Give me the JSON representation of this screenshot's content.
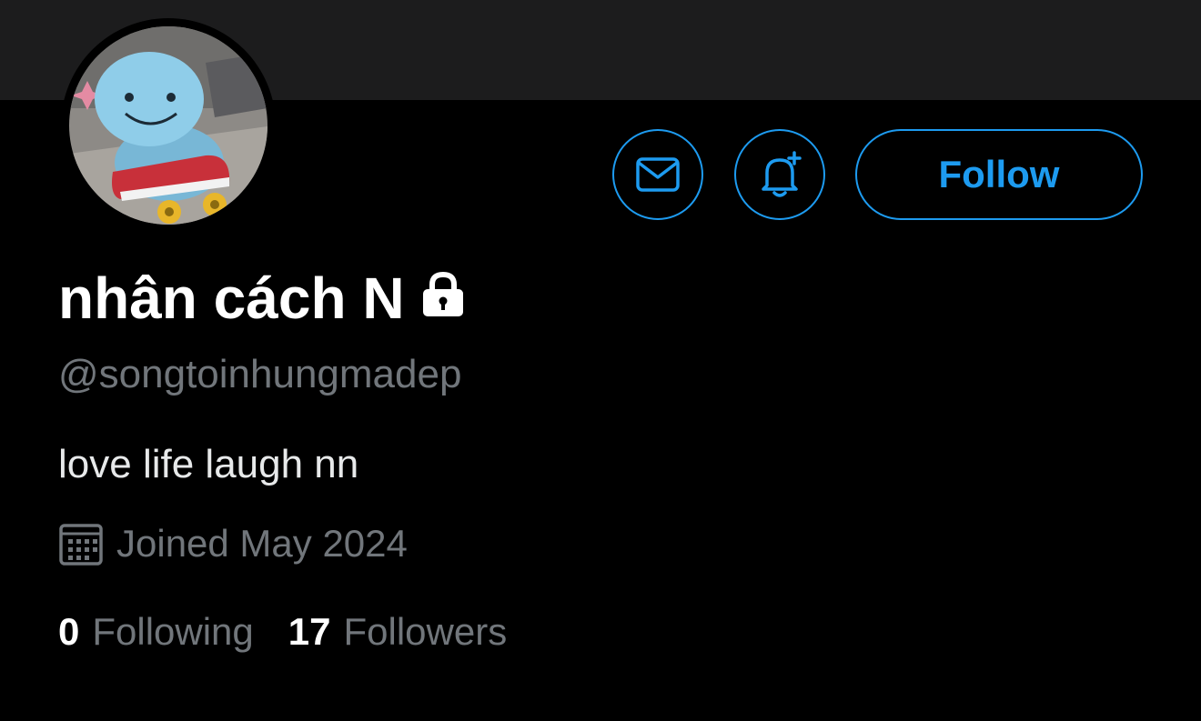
{
  "profile": {
    "display_name": "nhân cách N",
    "handle": "@songtoinhungmadep",
    "bio": "love life laugh nn",
    "joined": "Joined May 2024",
    "protected": true
  },
  "actions": {
    "follow_label": "Follow",
    "message_icon": "envelope-icon",
    "notify_icon": "bell-plus-icon"
  },
  "stats": {
    "following_count": "0",
    "following_label": "Following",
    "followers_count": "17",
    "followers_label": "Followers"
  },
  "colors": {
    "accent": "#1d9bf0",
    "background": "#000000",
    "banner": "#1c1c1d",
    "muted_text": "#71767b",
    "primary_text": "#ffffff"
  }
}
